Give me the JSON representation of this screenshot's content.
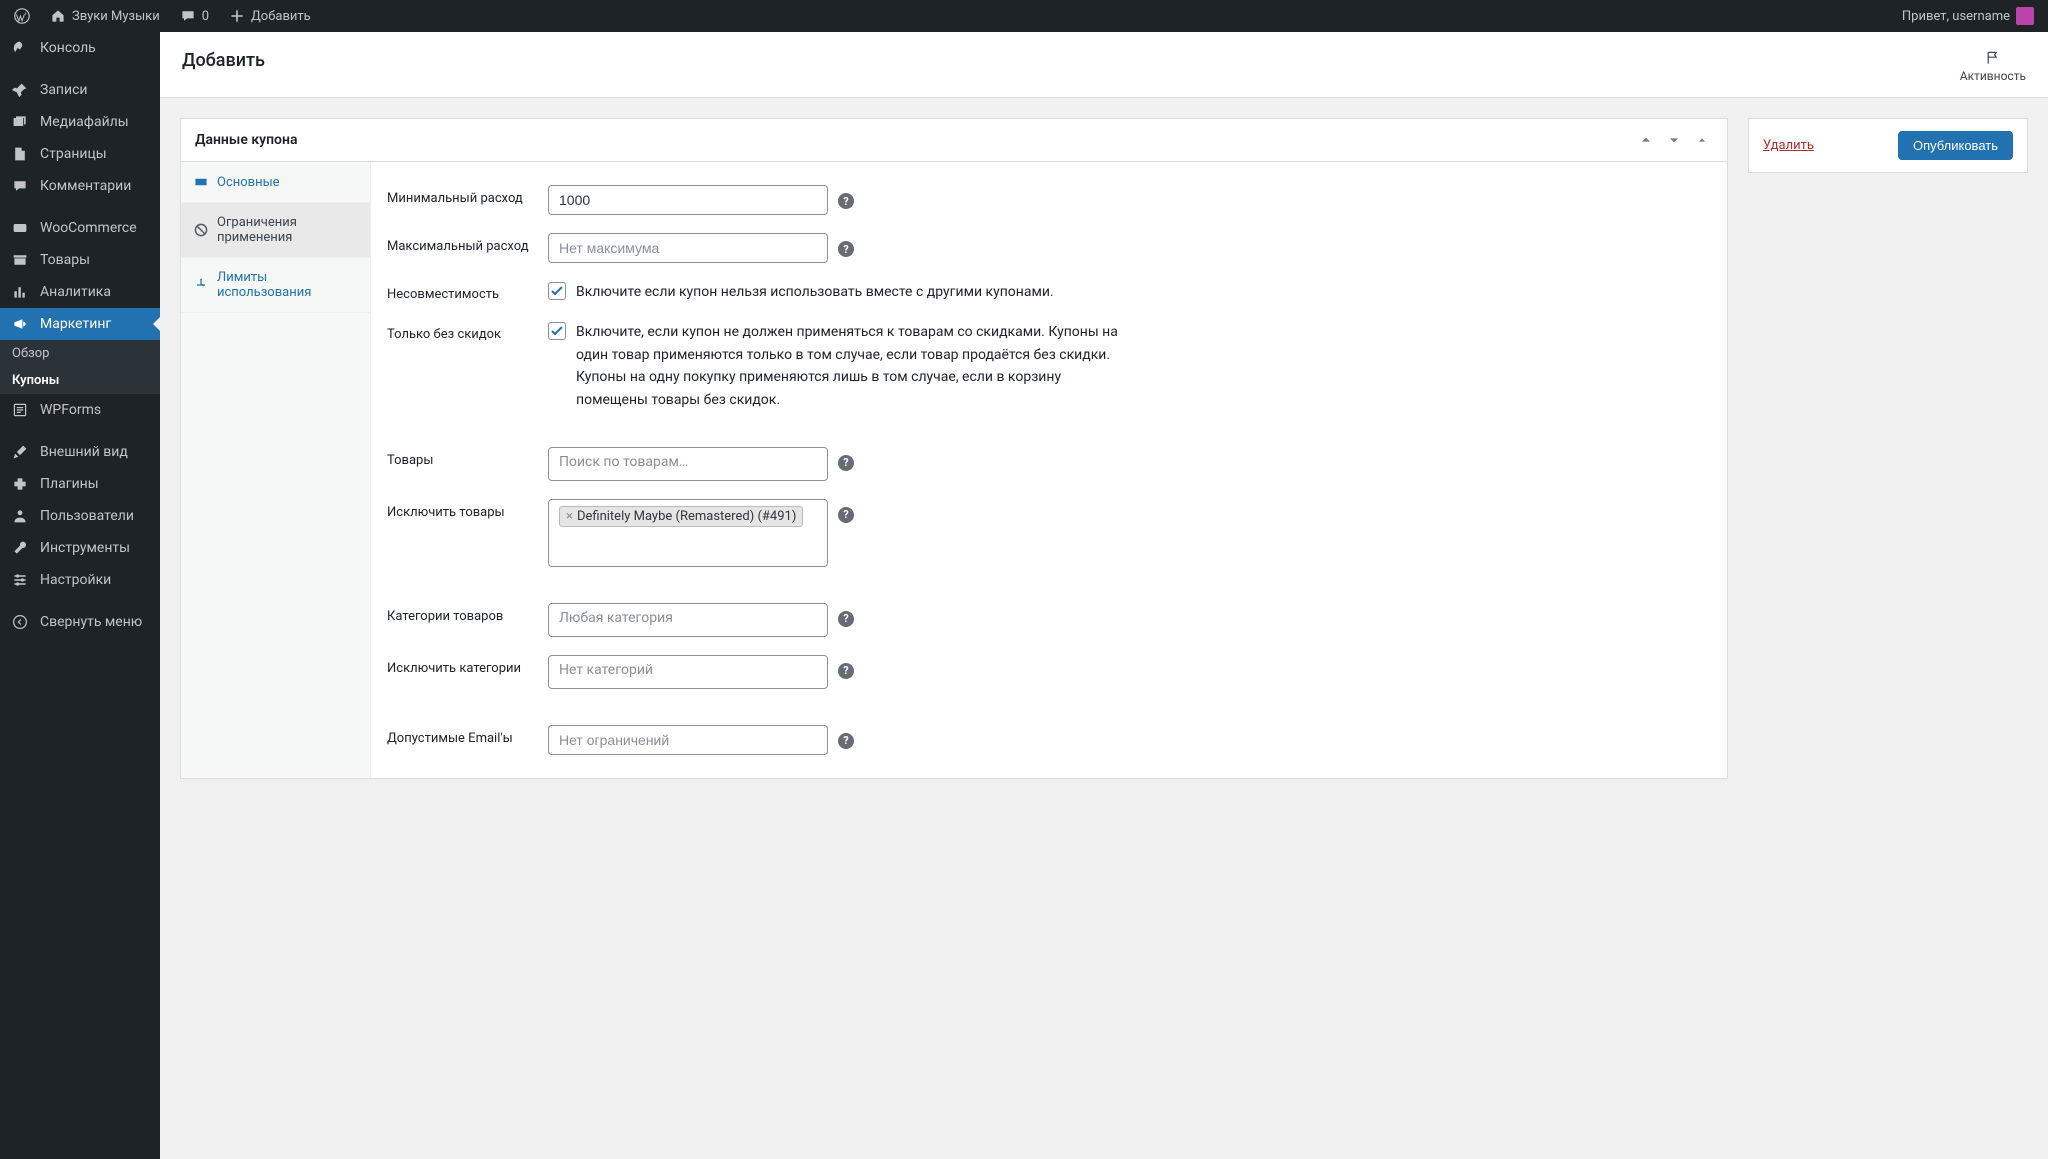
{
  "topbar": {
    "site_name": "Звуки Музыки",
    "comments_count": "0",
    "add_label": "Добавить",
    "greeting": "Привет, username"
  },
  "sidebar": {
    "items": [
      {
        "label": "Консоль"
      },
      {
        "label": "Записи"
      },
      {
        "label": "Медиафайлы"
      },
      {
        "label": "Страницы"
      },
      {
        "label": "Комментарии"
      },
      {
        "label": "WooCommerce"
      },
      {
        "label": "Товары"
      },
      {
        "label": "Аналитика"
      },
      {
        "label": "Маркетинг"
      },
      {
        "label": "WPForms"
      },
      {
        "label": "Внешний вид"
      },
      {
        "label": "Плагины"
      },
      {
        "label": "Пользователи"
      },
      {
        "label": "Инструменты"
      },
      {
        "label": "Настройки"
      }
    ],
    "marketing_sub": [
      {
        "label": "Обзор"
      },
      {
        "label": "Купоны"
      }
    ],
    "collapse": "Свернуть меню"
  },
  "header": {
    "title": "Добавить",
    "activity": "Активность"
  },
  "publish": {
    "delete": "Удалить",
    "publish": "Опубликовать"
  },
  "panel": {
    "title": "Данные купона",
    "tabs": {
      "general": "Основные",
      "usage_restriction": "Ограничения применения",
      "usage_limits": "Лимиты использования"
    }
  },
  "form": {
    "min_spend": {
      "label": "Минимальный расход",
      "value": "1000"
    },
    "max_spend": {
      "label": "Максимальный расход",
      "placeholder": "Нет максимума"
    },
    "individual": {
      "label": "Несовместимость",
      "text": "Включите если купон нельзя использовать вместе с другими купонами."
    },
    "exclude_sale": {
      "label": "Только без скидок",
      "text": "Включите, если купон не должен применяться к товарам со скидками. Купоны на один товар применяются только в том случае, если товар продаётся без скидки. Купоны на одну покупку применяются лишь в том случае, если в корзину помещены товары без скидок."
    },
    "products": {
      "label": "Товары",
      "placeholder": "Поиск по товарам…"
    },
    "exclude_products": {
      "label": "Исключить товары",
      "chips": [
        "Definitely Maybe (Remastered) (#491)"
      ]
    },
    "categories": {
      "label": "Категории товаров",
      "placeholder": "Любая категория"
    },
    "exclude_categories": {
      "label": "Исключить категории",
      "placeholder": "Нет категорий"
    },
    "emails": {
      "label": "Допустимые Email'ы",
      "placeholder": "Нет ограничений"
    }
  }
}
